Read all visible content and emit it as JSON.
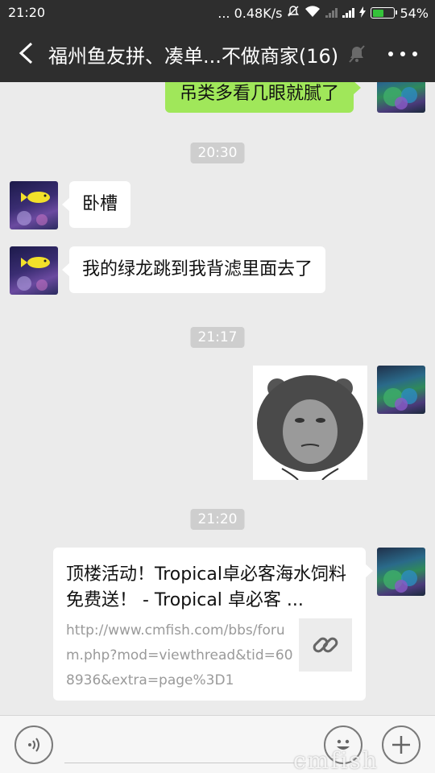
{
  "status_bar": {
    "time": "21:20",
    "network_speed": "... 0.48K/s",
    "battery": "54%"
  },
  "header": {
    "title": "福州鱼友拼、凑单...不做商家(16)"
  },
  "messages": [
    {
      "side": "right",
      "type": "text",
      "text": "吊类多看几眼就腻了"
    },
    {
      "type": "time",
      "text": "20:30"
    },
    {
      "side": "left",
      "type": "text",
      "text": "卧槽"
    },
    {
      "side": "left",
      "type": "text",
      "text": "我的绿龙跳到我背滤里面去了"
    },
    {
      "type": "time",
      "text": "21:17"
    },
    {
      "side": "right",
      "type": "sticker"
    },
    {
      "type": "time",
      "text": "21:20"
    },
    {
      "side": "right",
      "type": "link",
      "title": "顶楼活动！Tropical卓必客海水饲料免费送！ - Tropical 卓必客 ...",
      "url": "http://www.cmfish.com/bbs/forum.php?mod=viewthread&tid=608936&extra=page%3D1"
    }
  ],
  "watermark": "cmfish"
}
